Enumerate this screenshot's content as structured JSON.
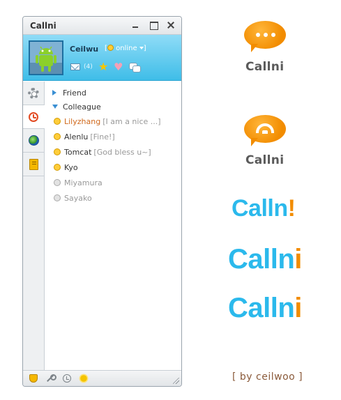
{
  "window": {
    "title": "Callni",
    "username": "Ceilwu",
    "status": "online",
    "mail_count": "(4)"
  },
  "groups": [
    {
      "label": "Friend",
      "expanded": false
    },
    {
      "label": "Colleague",
      "expanded": true
    }
  ],
  "contacts": [
    {
      "name": "Lilyzhang",
      "message": "[I am a nice ...]",
      "online": true,
      "selected": true
    },
    {
      "name": "Alenlu",
      "message": "[Fine!]",
      "online": true,
      "selected": false
    },
    {
      "name": "Tomcat",
      "message": "[God bless u~]",
      "online": true,
      "selected": false
    },
    {
      "name": "Kyo",
      "message": "",
      "online": true,
      "selected": false
    },
    {
      "name": "Miyamura",
      "message": "",
      "online": false,
      "selected": false
    },
    {
      "name": "Sayako",
      "message": "",
      "online": false,
      "selected": false
    }
  ],
  "logos": {
    "logo1_word": "Callni",
    "logo2_word": "Callni",
    "logo3_text": "Calln",
    "logo3_mark": "!",
    "logo4_text": "Calln",
    "logo4_mark": "i",
    "logo5_text": "Calln",
    "logo5_mark": "i",
    "byline": "[ by ceilwoo ]"
  },
  "colors": {
    "brand_blue": "#2bb9ec",
    "brand_orange": "#f28c00",
    "selected_contact": "#d0691c"
  },
  "icons": {
    "sidebar": [
      "gear-icon",
      "alarm-clock-icon",
      "globe-icon",
      "address-book-icon"
    ],
    "footer": [
      "shield-icon",
      "wrench-icon",
      "clock-icon",
      "sun-icon"
    ],
    "profile": [
      "mail-icon",
      "star-icon",
      "heart-icon",
      "chat-bubbles-icon"
    ]
  }
}
